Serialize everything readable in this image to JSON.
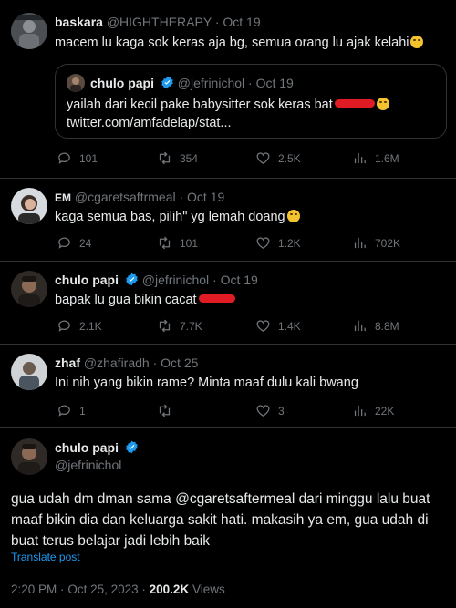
{
  "tweets": [
    {
      "name": "baskara",
      "handle": "@HIGHTHERAPY",
      "dot": "·",
      "date": "Oct 19",
      "text": "macem lu kaga sok keras aja bg, semua orang lu ajak kelahi",
      "quote": {
        "name": "chulo papi",
        "handle": "@jefrinichol",
        "dot": "·",
        "date": "Oct 19",
        "text": "yailah dari kecil pake babysitter sok keras bat",
        "link": "twitter.com/amfadelap/stat..."
      },
      "replies": "101",
      "retweets": "354",
      "likes": "2.5K",
      "views": "1.6M"
    },
    {
      "name": "EM",
      "handle": "@cgaretsaftrmeal",
      "dot": "·",
      "date": "Oct 19",
      "text": "kaga semua bas, pilih\" yg lemah doang",
      "replies": "24",
      "retweets": "101",
      "likes": "1.2K",
      "views": "702K"
    },
    {
      "name": "chulo papi",
      "handle": "@jefrinichol",
      "dot": "·",
      "date": "Oct 19",
      "text": "bapak lu gua bikin cacat",
      "replies": "2.1K",
      "retweets": "7.7K",
      "likes": "1.4K",
      "views": "8.8M"
    },
    {
      "name": "zhaf",
      "handle": "@zhafiradh",
      "dot": "·",
      "date": "Oct 25",
      "text": "Ini nih yang bikin rame? Minta maaf dulu kali bwang",
      "replies": "1",
      "retweets": "",
      "likes": "3",
      "views": "22K"
    }
  ],
  "main": {
    "name": "chulo papi",
    "handle": "@jefrinichol",
    "lines": [
      "gua udah dm dman sama @cgaretsaftermeal dari minggu lalu buat",
      "maaf bikin dia dan keluarga sakit hati. makasih ya em, gua udah di",
      "buat terus belajar jadi lebih baik"
    ],
    "translate": "Translate post",
    "time": "2:20 PM",
    "dot": "·",
    "date": "Oct 25, 2023",
    "dot2": "·",
    "views_count": "200.2K",
    "views_label": "Views"
  },
  "colors": {
    "background": "#000000",
    "text": "#e7e9ea",
    "muted": "#71767b",
    "link": "#1d9bf0",
    "verified": "#1d9bf0",
    "redaction": "#e01b24"
  }
}
